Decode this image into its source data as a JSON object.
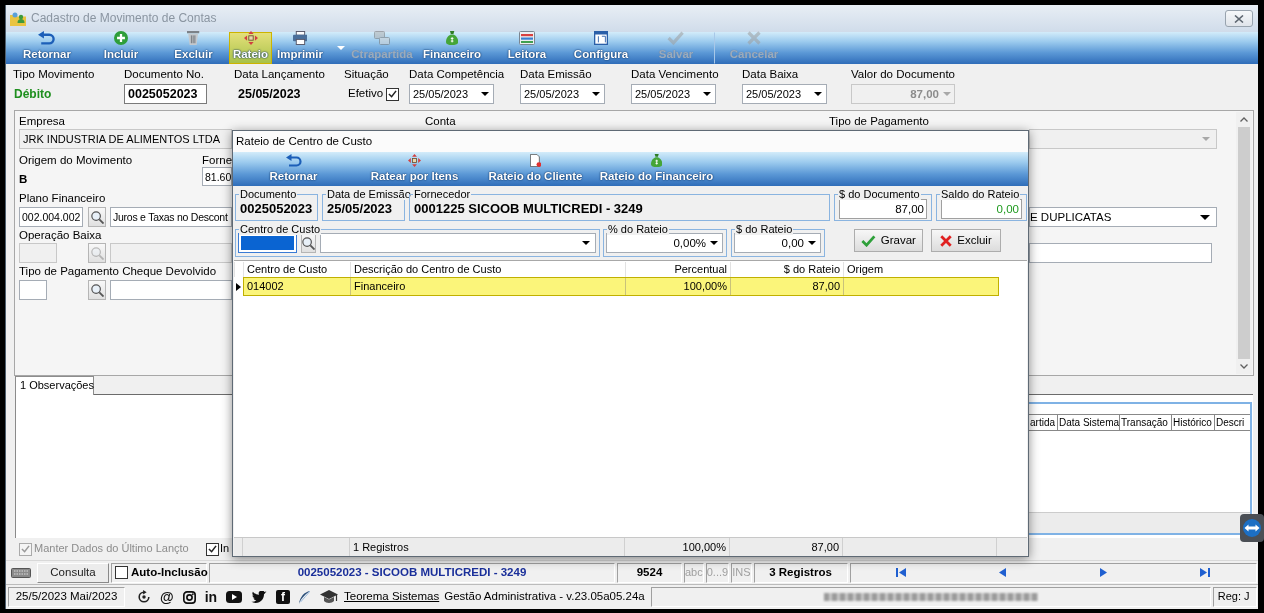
{
  "window": {
    "title": "Cadastro de Movimento de Contas"
  },
  "toolbar": [
    {
      "label": "Retornar",
      "disabled": false,
      "selected": false,
      "menu": false
    },
    {
      "label": "Incluir",
      "disabled": false,
      "selected": false,
      "menu": false
    },
    {
      "label": "Excluir",
      "disabled": false,
      "selected": false,
      "menu": false
    },
    {
      "label": "Rateio",
      "disabled": false,
      "selected": true,
      "menu": false
    },
    {
      "label": "Imprimir",
      "disabled": false,
      "selected": false,
      "menu": true
    },
    {
      "label": "Ctrapartida",
      "disabled": true,
      "selected": false,
      "menu": false
    },
    {
      "label": "Financeiro",
      "disabled": false,
      "selected": false,
      "menu": false
    },
    {
      "label": "Leitora",
      "disabled": false,
      "selected": false,
      "menu": false
    },
    {
      "label": "Configura",
      "disabled": false,
      "selected": false,
      "menu": false
    },
    {
      "label": "Salvar",
      "disabled": true,
      "selected": false,
      "menu": false
    },
    {
      "label": "Cancelar",
      "disabled": true,
      "selected": false,
      "menu": false
    }
  ],
  "header": [
    {
      "kind": "status",
      "label": "Tipo Movimento",
      "value": "Débito"
    },
    {
      "kind": "input",
      "label": "Documento No.",
      "value": "0025052023"
    },
    {
      "kind": "text",
      "label": "Data Lançamento",
      "value": "25/05/2023"
    },
    {
      "kind": "check",
      "label": "Situação",
      "value": "Efetivo",
      "checked": true
    },
    {
      "kind": "date",
      "label": "Data Competência",
      "value": "25/05/2023"
    },
    {
      "kind": "date",
      "label": "Data Emissão",
      "value": "25/05/2023"
    },
    {
      "kind": "date",
      "label": "Data Vencimento",
      "value": "25/05/2023"
    },
    {
      "kind": "date",
      "label": "Data Baixa",
      "value": "25/05/2023"
    },
    {
      "kind": "amount",
      "label": "Valor do Documento",
      "value": "87,00",
      "disabled": true
    }
  ],
  "form": {
    "column_labels": [
      "Empresa",
      "Conta",
      "Tipo de Pagamento"
    ],
    "empresa": "JRK INDUSTRIA DE ALIMENTOS LTDA",
    "tipo_pagamento": {
      "disabled": true
    },
    "origem": {
      "label": "Origem do Movimento",
      "value": "B"
    },
    "fornecedor": {
      "label": "Forne",
      "value": "81.60"
    },
    "lookups": [
      {
        "label": "Plano Financeiro",
        "code": "002.004.002",
        "description": "Juros e Taxas no Descont",
        "disabled": false
      },
      {
        "label": "Operação Baixa",
        "disabled": true
      },
      {
        "label": "Tipo de Pagamento Cheque Devolvido",
        "disabled": false
      }
    ],
    "select": {
      "value": "E DUPLICATAS"
    }
  },
  "tabs": [
    {
      "label": "1 Observações",
      "selected": true
    }
  ],
  "history_grid": {
    "columns": [
      "artida",
      "Data Sistema",
      "Transação",
      "Histórico",
      "Descri"
    ]
  },
  "options": [
    {
      "label": "Manter Dados do Último Lançto",
      "checked": true,
      "disabled": true
    },
    {
      "label": "In",
      "checked": true,
      "disabled": false
    }
  ],
  "status_bar": {
    "mode": "Consulta",
    "auto_inclusion": {
      "label": "Auto-Inclusão",
      "checked": false
    },
    "record": "0025052023 - SICOOB MULTICREDI - 3249",
    "code": "9524",
    "indicators": [
      {
        "label": "abc",
        "on": false
      },
      {
        "label": "0...9",
        "on": false
      },
      {
        "label": "INS",
        "on": false
      }
    ],
    "count": "3 Registros"
  },
  "footer": {
    "date": "25/5/2023 Mai/2023",
    "social": [
      {
        "kind": "icon"
      },
      {
        "kind": "glyph",
        "text": "@"
      },
      {
        "kind": "icon"
      },
      {
        "kind": "glyph",
        "text": "in"
      },
      {
        "kind": "icon"
      },
      {
        "kind": "icon"
      },
      {
        "kind": "tile",
        "text": "f"
      },
      {
        "kind": "icon"
      }
    ],
    "link": "Teorema Sistemas",
    "product": "Gestão Administrativa - v.23.05a05.24a",
    "reg": "Reg: J"
  },
  "dialog": {
    "title": "Rateio de Centro de Custo",
    "toolbar": [
      {
        "label": "Retornar"
      },
      {
        "label": "Ratear por Itens"
      },
      {
        "label": "Rateio do Cliente"
      },
      {
        "label": "Rateio do Financeiro"
      }
    ],
    "info": [
      {
        "kind": "static",
        "label": "Documento",
        "value": "0025052023"
      },
      {
        "kind": "static",
        "label": "Data de Emissão",
        "value": "25/05/2023"
      },
      {
        "kind": "static",
        "label": "Fornecedor",
        "value": "0001225 SICOOB MULTICREDI - 3249"
      },
      {
        "kind": "input",
        "label": "$ do Documento",
        "value": "87,00"
      },
      {
        "kind": "balance",
        "label": "Saldo do Rateio",
        "value": "0,00"
      }
    ],
    "cost_center": {
      "label": "Centro de Custo",
      "text_selected": true
    },
    "split": [
      {
        "label": "% do Rateio",
        "value": "0,00%"
      },
      {
        "label": "$ do Rateio",
        "value": "0,00"
      }
    ],
    "buttons": [
      {
        "label": "Gravar"
      },
      {
        "label": "Excluir"
      }
    ],
    "grid": {
      "columns": [
        "Centro de Custo",
        "Descrição do Centro de Custo",
        "Percentual",
        "$ do Rateio",
        "Origem"
      ],
      "rows": [
        {
          "cells": [
            "014002",
            "Financeiro",
            "100,00%",
            "87,00"
          ],
          "selected": true
        }
      ],
      "totals": {
        "count": "1 Registros",
        "percent": "100,00%",
        "amount": "87,00"
      }
    }
  }
}
